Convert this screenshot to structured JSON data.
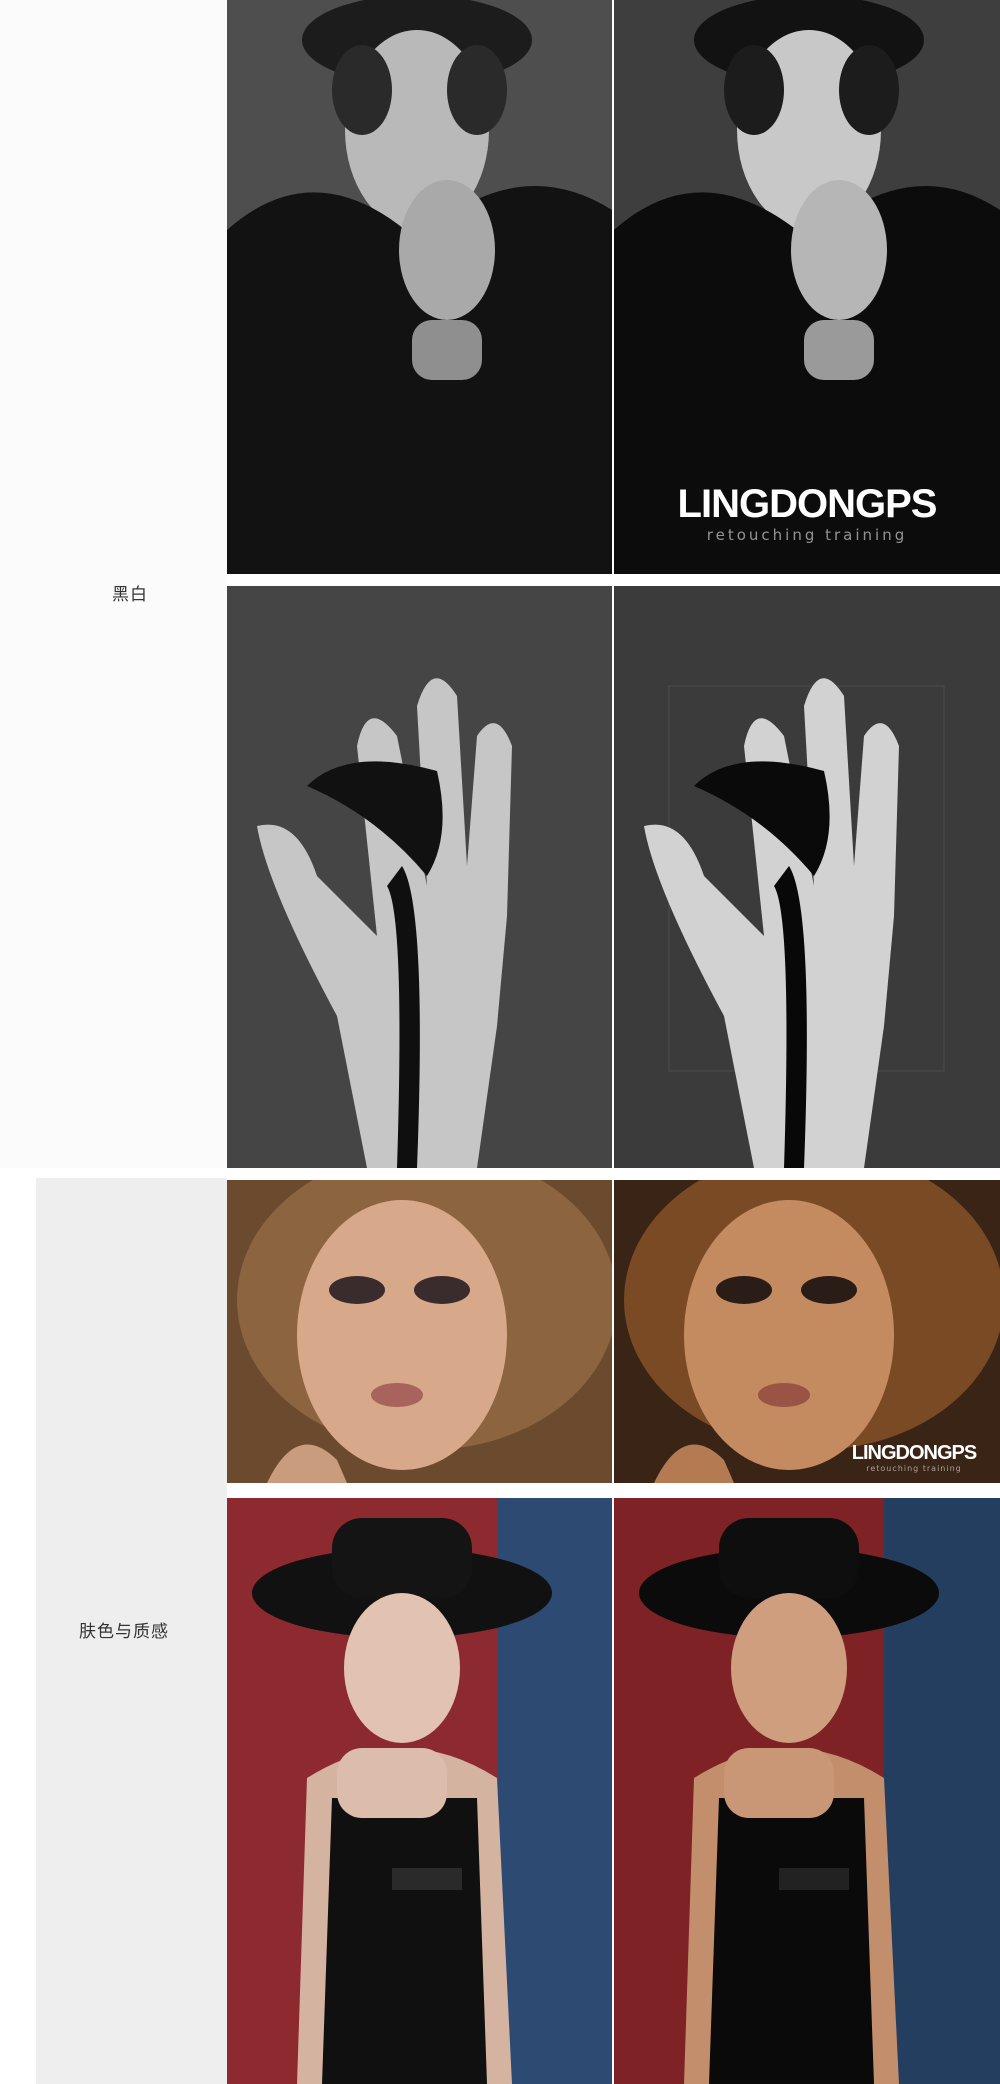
{
  "sections": [
    {
      "id": "bw",
      "label": "黑白"
    },
    {
      "id": "skin",
      "label": "肤色与质感"
    }
  ],
  "watermark": {
    "brand": "LINGDONGPS",
    "tagline": "retouching training"
  },
  "photos": [
    {
      "id": "man-before",
      "subject": "man in cap, black and white",
      "state": "before"
    },
    {
      "id": "man-after",
      "subject": "man in cap, black and white",
      "state": "after"
    },
    {
      "id": "hand-before",
      "subject": "hand holding calla lily, black and white",
      "state": "before"
    },
    {
      "id": "hand-after",
      "subject": "hand holding calla lily, black and white",
      "state": "after"
    },
    {
      "id": "woman-curls-before",
      "subject": "woman with curly hair portrait",
      "state": "before"
    },
    {
      "id": "woman-curls-after",
      "subject": "woman with curly hair portrait",
      "state": "after"
    },
    {
      "id": "woman-hat-before",
      "subject": "woman in black hat",
      "state": "before"
    },
    {
      "id": "woman-hat-after",
      "subject": "woman in black hat",
      "state": "after"
    }
  ]
}
